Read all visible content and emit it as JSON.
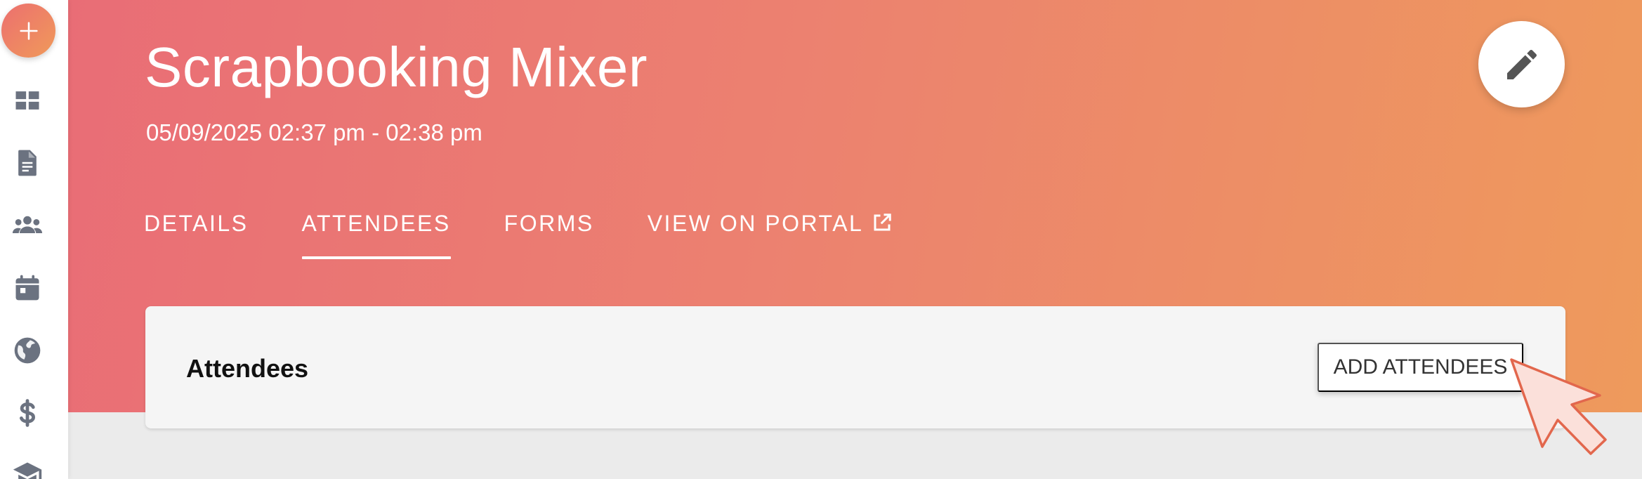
{
  "event": {
    "title": "Scrapbooking Mixer",
    "datetime": "05/09/2025 02:37 pm - 02:38 pm"
  },
  "tabs": [
    {
      "label": "DETAILS",
      "active": false
    },
    {
      "label": "ATTENDEES",
      "active": true
    },
    {
      "label": "FORMS",
      "active": false
    },
    {
      "label": "VIEW ON PORTAL",
      "active": false,
      "icon": "external-link-icon"
    }
  ],
  "card": {
    "title": "Attendees",
    "add_button_label": "ADD ATTENDEES"
  },
  "sidebar": {
    "add_icon": "plus-icon",
    "items": [
      {
        "icon": "dashboard-icon"
      },
      {
        "icon": "document-icon"
      },
      {
        "icon": "people-icon"
      },
      {
        "icon": "calendar-icon"
      },
      {
        "icon": "globe-icon"
      },
      {
        "icon": "dollar-icon"
      },
      {
        "icon": "graduation-cap-icon"
      }
    ]
  },
  "colors": {
    "header_gradient_start": "#e96d76",
    "header_gradient_end": "#ee9a5c",
    "sidebar_icon": "#6b7280",
    "page_background": "#ebebeb",
    "card_background": "#f5f5f5"
  }
}
